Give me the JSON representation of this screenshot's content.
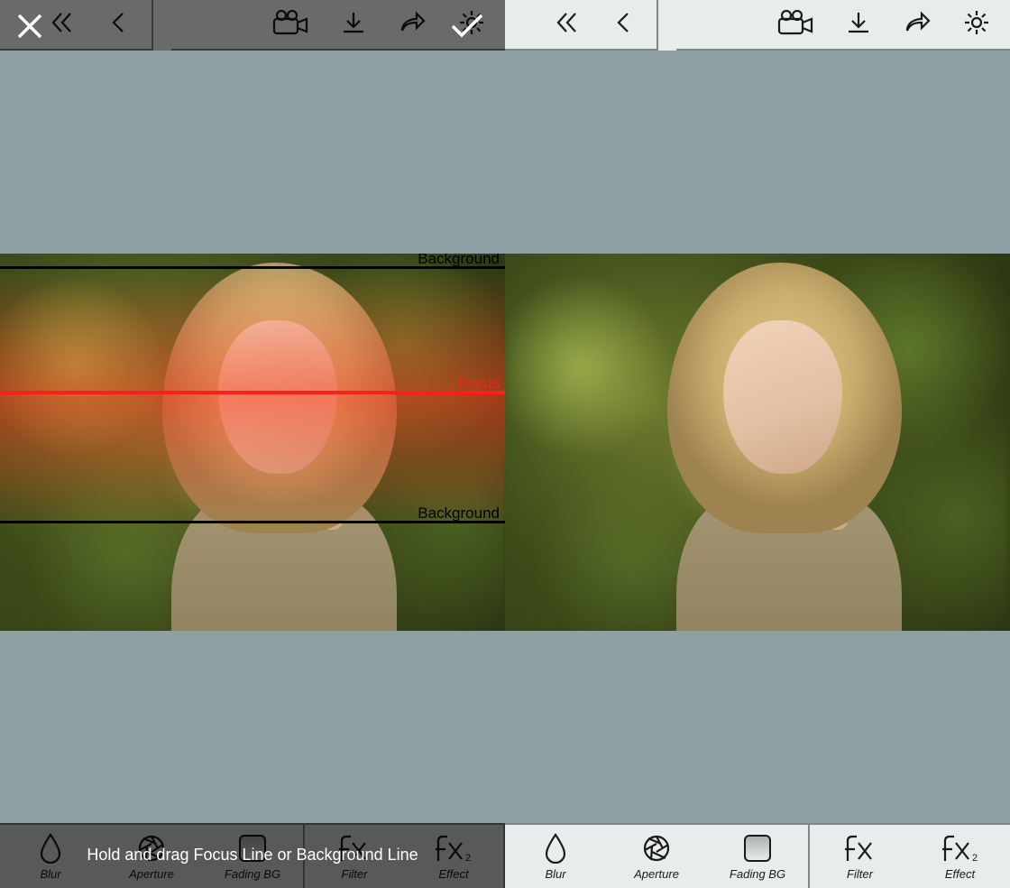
{
  "left": {
    "toast": "Hold and drag Focus Line or Background Line",
    "lines": {
      "bg_label": "Background",
      "focus_label": "Focus"
    },
    "tabs": {
      "blur": "Blur",
      "aperture": "Aperture",
      "fading": "Fading BG",
      "filter": "Filter",
      "effect": "Effect"
    }
  },
  "right": {
    "tabs": {
      "blur": "Blur",
      "aperture": "Aperture",
      "fading": "Fading BG",
      "filter": "Filter",
      "effect": "Effect"
    }
  }
}
